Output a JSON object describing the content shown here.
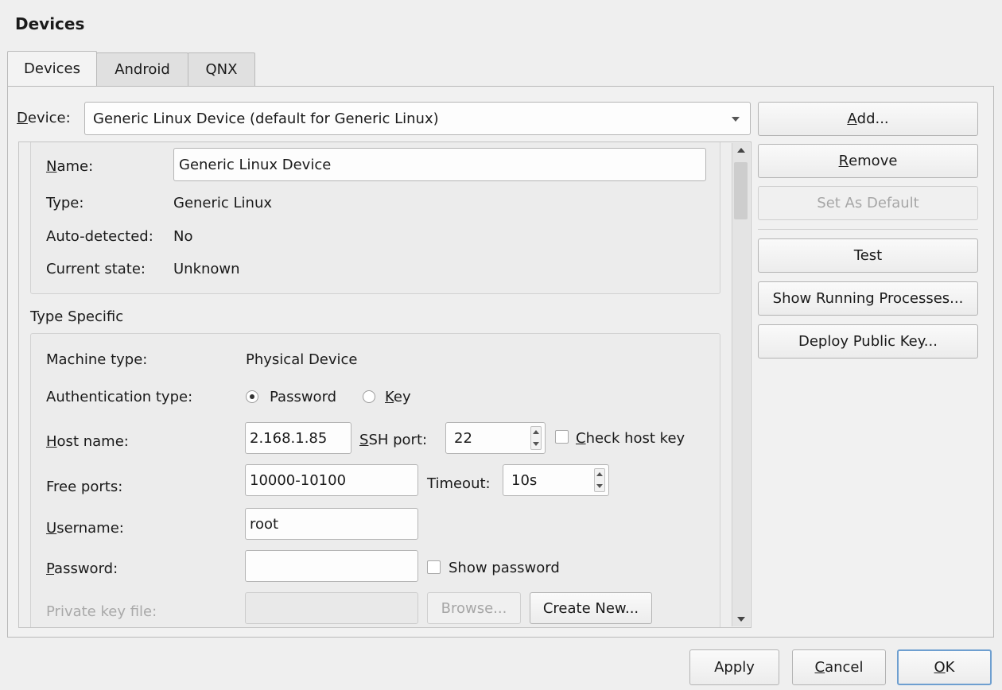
{
  "title": "Devices",
  "tabs": [
    {
      "label": "Devices"
    },
    {
      "label": "Android"
    },
    {
      "label": "QNX"
    }
  ],
  "device_label": "Device:",
  "device_selected": "Generic Linux Device (default for Generic Linux)",
  "side_buttons": {
    "add": "Add...",
    "remove": "Remove",
    "set_default": "Set As Default",
    "test": "Test",
    "show_processes": "Show Running Processes...",
    "deploy_key": "Deploy Public Key..."
  },
  "general": {
    "name_label": "Name:",
    "name_value": "Generic Linux Device",
    "type_label": "Type:",
    "type_value": "Generic Linux",
    "auto_label": "Auto-detected:",
    "auto_value": "No",
    "state_label": "Current state:",
    "state_value": "Unknown"
  },
  "type_specific": {
    "heading": "Type Specific",
    "machine_label": "Machine type:",
    "machine_value": "Physical Device",
    "auth_label": "Authentication type:",
    "auth_password": "Password",
    "auth_key": "Key",
    "host_label": "Host name:",
    "host_value": "2.168.1.85",
    "ssh_label": "SSH port:",
    "ssh_value": "22",
    "check_host": "Check host key",
    "ports_label": "Free ports:",
    "ports_value": "10000-10100",
    "timeout_label": "Timeout:",
    "timeout_value": "10s",
    "user_label": "Username:",
    "user_value": "root",
    "pass_label": "Password:",
    "pass_value": "",
    "show_pass": "Show password",
    "key_label": "Private key file:",
    "browse": "Browse...",
    "create_new": "Create New..."
  },
  "footer": {
    "apply": "Apply",
    "cancel": "Cancel",
    "ok": "OK"
  }
}
